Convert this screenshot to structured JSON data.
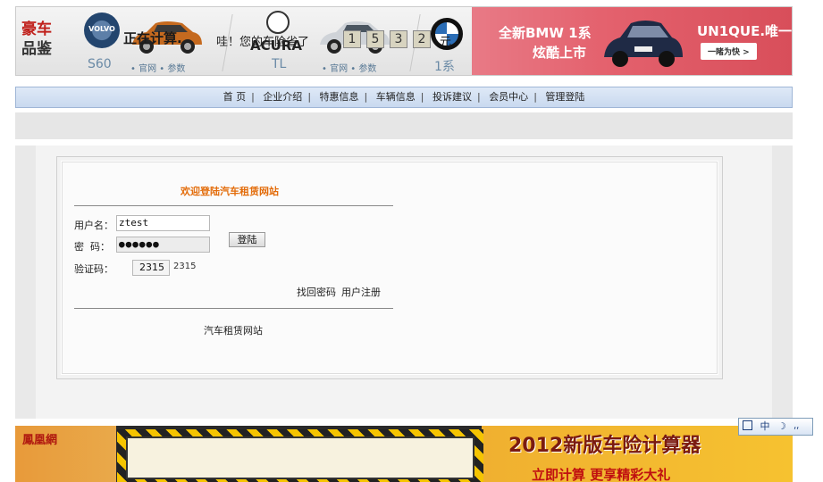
{
  "banner": {
    "tag_line1": "豪车",
    "tag_line2": "品鉴",
    "cars": [
      {
        "brand": "VOLVO",
        "model": "S60",
        "links": "• 官网  • 参数"
      },
      {
        "brand": "ACURA",
        "model": "TL",
        "links": "• 官网  • 参数"
      },
      {
        "brand": "BMW",
        "model": "1系"
      }
    ],
    "bmw_ad": {
      "line1": "全新BMW 1系",
      "line2": "炫酷上市",
      "slogan": "UN1QUE.唯一",
      "button": "一睹为快 >"
    }
  },
  "nav": {
    "items": [
      "首 页",
      "企业介绍",
      "特惠信息",
      "车辆信息",
      "投诉建议",
      "会员中心",
      "管理登陆"
    ]
  },
  "login": {
    "welcome": "欢迎登陆汽车租赁网站",
    "username_label": "用户名：",
    "username_value": "ztest",
    "password_label": "密  码：",
    "password_value": "●●●●●●",
    "captcha_label": "验证码：",
    "captcha_input": "2315",
    "captcha_code": "2315",
    "login_button": "登陆",
    "forgot_link": "找回密码",
    "register_link": "用户注册",
    "footer": "汽车租赁网站"
  },
  "bottom_ad": {
    "logo": "鳳凰網",
    "calc_text": "正在计算.",
    "saving_text": "哇！您的车险省了",
    "digits": [
      "1",
      "5",
      "3",
      "2"
    ],
    "unit": "元",
    "title": "2012新版车险计算器",
    "subtitle": "立即计算 更享精彩大礼"
  },
  "ime": {
    "items": [
      "中",
      "☽",
      "⸴⸴"
    ]
  }
}
